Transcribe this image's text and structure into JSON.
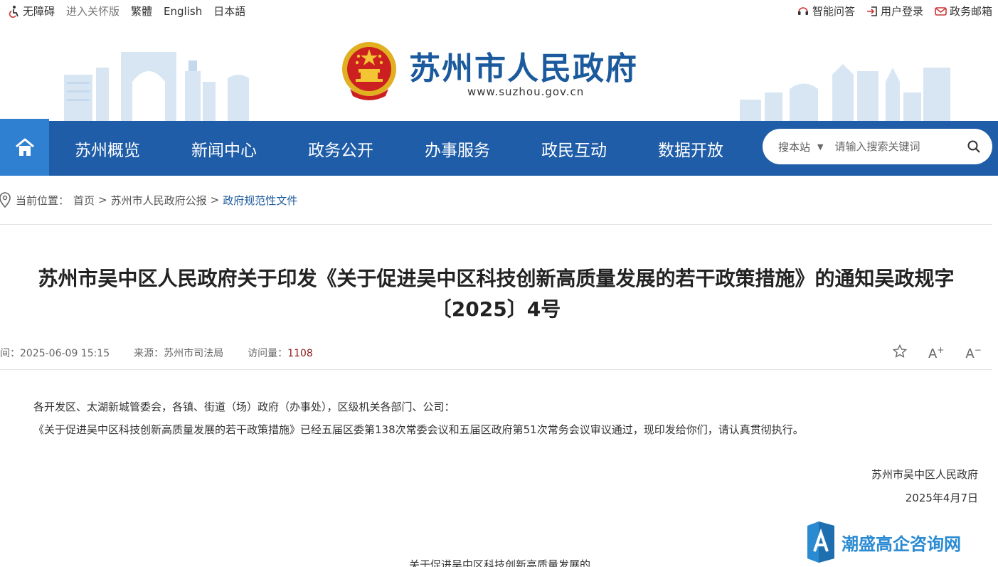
{
  "topbar": {
    "accessibility": "无障碍",
    "elder_mode": "进入关怀版",
    "traditional": "繁體",
    "english": "English",
    "japanese": "日本語",
    "smart_qa": "智能问答",
    "login": "用户登录",
    "mailbox": "政务邮箱"
  },
  "header": {
    "site_name": "苏州市人民政府",
    "site_url": "www.suzhou.gov.cn"
  },
  "nav": {
    "home_icon": "home-icon",
    "items": [
      "苏州概览",
      "新闻中心",
      "政务公开",
      "办事服务",
      "政民互动",
      "数据开放"
    ],
    "search_scope": "搜本站",
    "search_placeholder": "请输入搜索关键词"
  },
  "breadcrumb": {
    "label": "当前位置：",
    "items": [
      "首页",
      "苏州市人民政府公报",
      "政府规范性文件"
    ],
    "sep": ">"
  },
  "article": {
    "title_line1": "苏州市吴中区人民政府关于印发《关于促进吴中区科技创新高质量发展的若干政策措施》的通知吴政规字",
    "title_line2": "〔2025〕4号",
    "time_label": "时间：",
    "time_value": "2025-06-09 15:15",
    "source_label": "来源：",
    "source_value": "苏州市司法局",
    "views_label": "访问量：",
    "views_value": "1108",
    "font_larger": "A",
    "font_larger_sign": "+",
    "font_smaller": "A",
    "font_smaller_sign": "−",
    "para1": "各开发区、太湖新城管委会，各镇、街道（场）政府（办事处），区级机关各部门、公司：",
    "para2": "《关于促进吴中区科技创新高质量发展的若干政策措施》已经五届区委第138次常委会议和五届区政府第51次常务会议审议通过，现印发给你们，请认真贯彻执行。",
    "signer": "苏州市吴中区人民政府",
    "sign_date": "2025年4月7日",
    "attachment_title": "关于促进吴中区科技创新高质量发展的"
  },
  "watermark": {
    "text": "潮盛高企咨询网"
  },
  "colors": {
    "nav_bg": "#1f5da8",
    "home_bg": "#2f80d0",
    "brand": "#1b5a9c",
    "count": "#8b1a1a"
  }
}
